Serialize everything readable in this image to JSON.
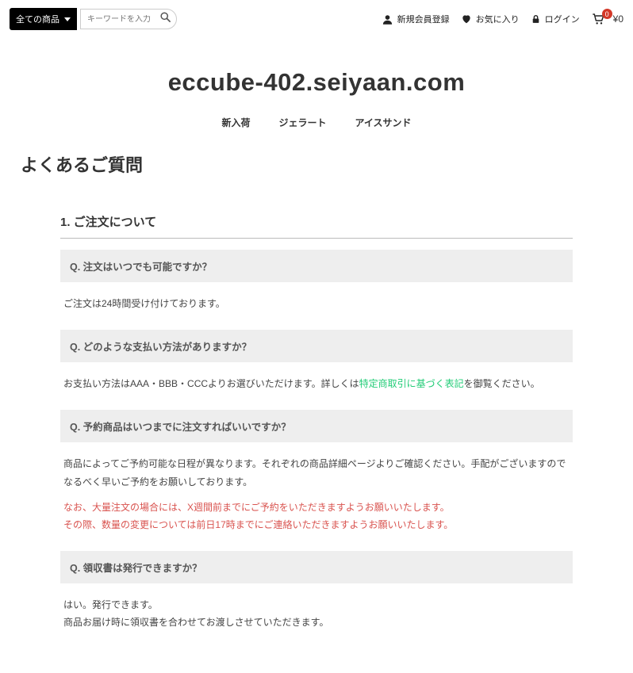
{
  "header": {
    "category_label": "全ての商品",
    "search_placeholder": "キーワードを入力",
    "nav": {
      "register": "新規会員登録",
      "favorite": "お気に入り",
      "login": "ログイン"
    },
    "cart": {
      "count": "0",
      "total": "¥0"
    }
  },
  "site_title": "eccube-402.seiyaan.com",
  "top_nav": [
    "新入荷",
    "ジェラート",
    "アイスサンド"
  ],
  "page_title": "よくあるご質問",
  "faq": {
    "section_title": "1. ご注文について",
    "items": [
      {
        "q": "Q.  注文はいつでも可能ですか？",
        "a_plain": "ご注文は24時間受け付けております。"
      },
      {
        "q": "Q.  どのような支払い方法がありますか？",
        "a_before": "お支払い方法はAAA・BBB・CCCよりお選びいただけます。詳しくは",
        "a_link": "特定商取引に基づく表記",
        "a_after": "を御覧ください。"
      },
      {
        "q": "Q.  予約商品はいつまでに注文すればいいですか？",
        "a_p1": "商品によってご予約可能な日程が異なります。それぞれの商品詳細ページよりご確認ください。手配がございますのでなるべく早いご予約をお願いしております。",
        "a_red1": "なお、大量注文の場合には、X週間前までにご予約をいただきますようお願いいたします。",
        "a_red2": "その際、数量の変更については前日17時までにご連絡いただきますようお願いいたします。"
      },
      {
        "q": "Q.  領収書は発行できますか？",
        "a_l1": "はい。発行できます。",
        "a_l2": "商品お届け時に領収書を合わせてお渡しさせていただきます。"
      }
    ]
  }
}
